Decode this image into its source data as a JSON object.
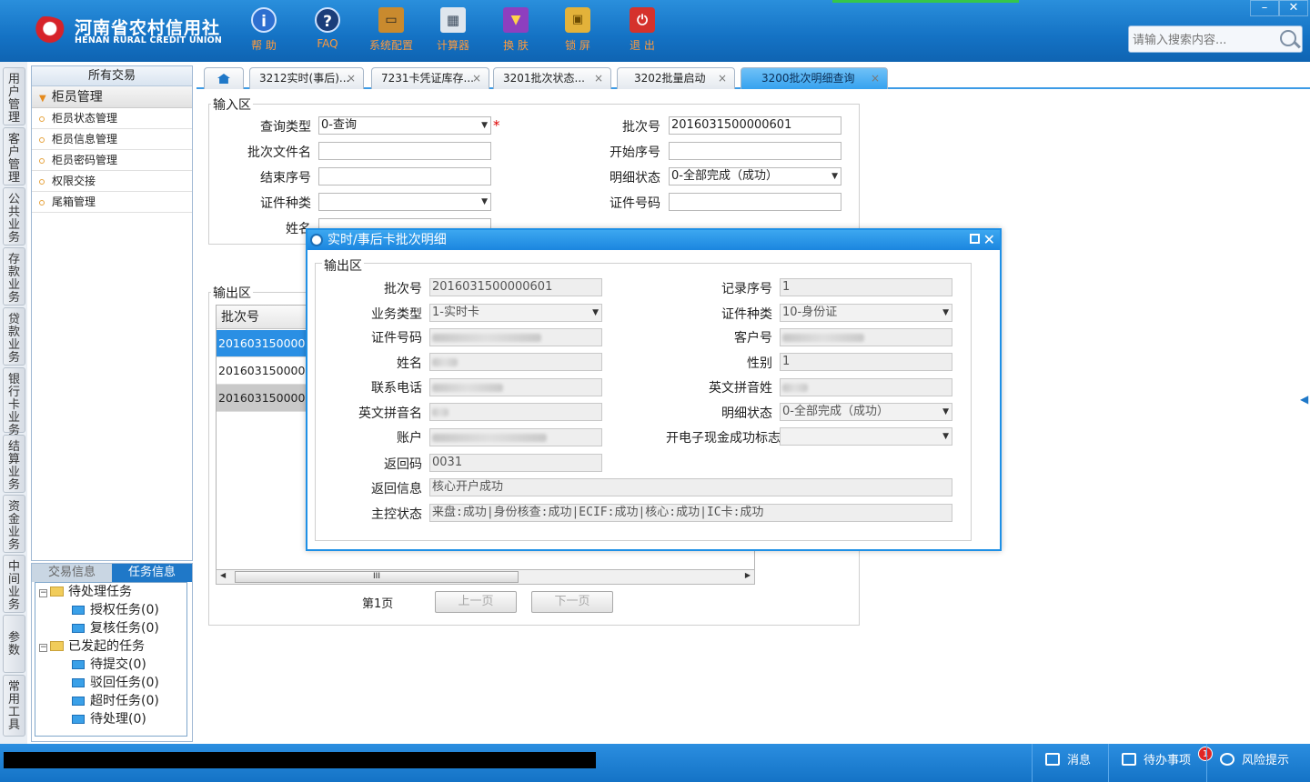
{
  "header": {
    "logo_cn": "河南省农村信用社",
    "logo_en": "HENAN RURAL CREDIT UNION",
    "toolbar": [
      {
        "label": "帮 助",
        "icon": "info-icon",
        "glyph": "i"
      },
      {
        "label": "FAQ",
        "icon": "help-icon",
        "glyph": "?"
      },
      {
        "label": "系统配置",
        "icon": "toolbox-icon",
        "glyph": "⚙"
      },
      {
        "label": "计算器",
        "icon": "calculator-icon",
        "glyph": "▦"
      },
      {
        "label": "换 肤",
        "icon": "shirt-icon",
        "glyph": "♥"
      },
      {
        "label": "锁 屏",
        "icon": "lock-icon",
        "glyph": "🔒"
      },
      {
        "label": "退 出",
        "icon": "power-icon",
        "glyph": "⏻"
      }
    ],
    "minimize": "–",
    "close": "✕",
    "search_placeholder": "请输入搜索内容..."
  },
  "vtabs": [
    "用户管理",
    "客户管理",
    "公共业务",
    "存款业务",
    "贷款业务",
    "银行卡业务",
    "结算业务",
    "资金业务",
    "中间业务",
    "参数",
    "常用工具"
  ],
  "left_panel": {
    "header": "所有交易",
    "group": "柜员管理",
    "items": [
      "柜员状态管理",
      "柜员信息管理",
      "柜员密码管理",
      "权限交接",
      "尾箱管理"
    ]
  },
  "task_panel": {
    "tab_trade": "交易信息",
    "tab_task": "任务信息",
    "pending": "待处理任务",
    "auth": "授权任务(0)",
    "review": "复核任务(0)",
    "initiated": "已发起的任务",
    "submit": "待提交(0)",
    "rejected": "驳回任务(0)",
    "timeout": "超时任务(0)",
    "processing": "待处理(0)"
  },
  "tabs": [
    "3212实时(事后)...",
    "7231卡凭证库存...",
    "3201批次状态...",
    "3202批量启动",
    "3200批次明细查询"
  ],
  "input_form": {
    "legend": "输入区",
    "query_type_label": "查询类型",
    "query_type": "0-查询",
    "required": "*",
    "batch_no_label": "批次号",
    "batch_no": "2016031500000601",
    "batch_file_label": "批次文件名",
    "start_seq_label": "开始序号",
    "end_seq_label": "结束序号",
    "detail_status_label": "明细状态",
    "detail_status": "0-全部完成（成功）",
    "id_type_label": "证件种类",
    "id_no_label": "证件号码",
    "name_label": "姓名"
  },
  "output": {
    "legend": "输出区",
    "col_batch": "批次号",
    "rows": [
      "20160315000006",
      "20160315000006",
      "20160315000006"
    ],
    "page": "第1页",
    "prev": "上一页",
    "next": "下一页",
    "thumb_grip": "III"
  },
  "dialog": {
    "title": "实时/事后卡批次明细",
    "legend": "输出区",
    "batch_no_label": "批次号",
    "batch_no": "2016031500000601",
    "record_seq_label": "记录序号",
    "record_seq": "1",
    "biz_type_label": "业务类型",
    "biz_type": "1-实时卡",
    "id_type_label": "证件种类",
    "id_type": "10-身份证",
    "id_no_label": "证件号码",
    "cust_no_label": "客户号",
    "name_label": "姓名",
    "gender_label": "性别",
    "gender": "1",
    "phone_label": "联系电话",
    "en_surname_label": "英文拼音姓",
    "en_name_label": "英文拼音名",
    "detail_status_label": "明细状态",
    "detail_status": "0-全部完成（成功）",
    "account_label": "账户",
    "ecash_label": "开电子现金成功标志",
    "ret_code_label": "返回码",
    "ret_code": "0031",
    "ret_msg_label": "返回信息",
    "ret_msg": "核心开户成功",
    "master_status_label": "主控状态",
    "master_status": "来盘:成功|身份核查:成功|ECIF:成功|核心:成功|IC卡:成功"
  },
  "status_bar": {
    "message": "消息",
    "todo": "待办事项",
    "todo_count": "1",
    "risk": "风险提示"
  },
  "colors": {
    "header": "#1472c4",
    "accent": "#1e90e6",
    "badge": "#e12525"
  }
}
